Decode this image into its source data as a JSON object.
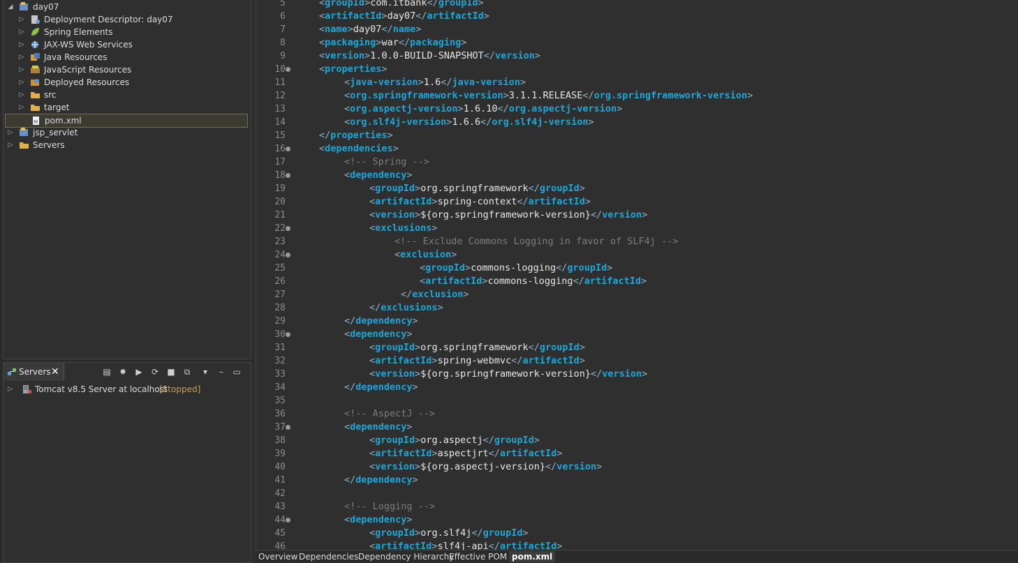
{
  "explorer": {
    "items": [
      {
        "label": "day07",
        "indent": 0,
        "arrow": "◢",
        "icon": "project-icon"
      },
      {
        "label": "Deployment Descriptor: day07",
        "indent": 1,
        "arrow": "▷",
        "icon": "descriptor-icon"
      },
      {
        "label": "Spring Elements",
        "indent": 1,
        "arrow": "▷",
        "icon": "spring-leaf-icon"
      },
      {
        "label": "JAX-WS Web Services",
        "indent": 1,
        "arrow": "▷",
        "icon": "webservice-icon"
      },
      {
        "label": "Java Resources",
        "indent": 1,
        "arrow": "▷",
        "icon": "java-resources-icon"
      },
      {
        "label": "JavaScript Resources",
        "indent": 1,
        "arrow": "▷",
        "icon": "js-resources-icon"
      },
      {
        "label": "Deployed Resources",
        "indent": 1,
        "arrow": "▷",
        "icon": "deployed-resources-icon"
      },
      {
        "label": "src",
        "indent": 1,
        "arrow": "▷",
        "icon": "folder-icon"
      },
      {
        "label": "target",
        "indent": 1,
        "arrow": "▷",
        "icon": "folder-icon"
      },
      {
        "label": "pom.xml",
        "indent": 1,
        "arrow": "",
        "icon": "xml-file-icon",
        "selected": true
      },
      {
        "label": "jsp_servlet",
        "indent": 0,
        "arrow": "▷",
        "icon": "project-icon"
      },
      {
        "label": "Servers",
        "indent": 0,
        "arrow": "▷",
        "icon": "folder-icon"
      }
    ]
  },
  "servers": {
    "tab_label": "Servers",
    "server_name": "Tomcat v8.5 Server at localhost",
    "server_status": "[Stopped]"
  },
  "editor": {
    "lines": [
      {
        "n": "5",
        "fold": false,
        "indent": 1,
        "parts": [
          [
            "t",
            "groupId"
          ],
          [
            "x",
            "com.itbank"
          ],
          [
            "c",
            "groupId"
          ]
        ]
      },
      {
        "n": "6",
        "fold": false,
        "indent": 1,
        "parts": [
          [
            "t",
            "artifactId"
          ],
          [
            "x",
            "day07"
          ],
          [
            "c",
            "artifactId"
          ]
        ]
      },
      {
        "n": "7",
        "fold": false,
        "indent": 1,
        "parts": [
          [
            "t",
            "name"
          ],
          [
            "x",
            "day07"
          ],
          [
            "c",
            "name"
          ]
        ]
      },
      {
        "n": "8",
        "fold": false,
        "indent": 1,
        "parts": [
          [
            "t",
            "packaging"
          ],
          [
            "x",
            "war"
          ],
          [
            "c",
            "packaging"
          ]
        ]
      },
      {
        "n": "9",
        "fold": false,
        "indent": 1,
        "parts": [
          [
            "t",
            "version"
          ],
          [
            "x",
            "1.0.0-BUILD-SNAPSHOT"
          ],
          [
            "c",
            "version"
          ]
        ]
      },
      {
        "n": "10",
        "fold": true,
        "indent": 1,
        "parts": [
          [
            "t",
            "properties"
          ]
        ]
      },
      {
        "n": "11",
        "fold": false,
        "indent": 2,
        "parts": [
          [
            "t",
            "java-version"
          ],
          [
            "x",
            "1.6"
          ],
          [
            "c",
            "java-version"
          ]
        ]
      },
      {
        "n": "12",
        "fold": false,
        "indent": 2,
        "parts": [
          [
            "t",
            "org.springframework-version"
          ],
          [
            "x",
            "3.1.1.RELEASE"
          ],
          [
            "c",
            "org.springframework-version"
          ]
        ]
      },
      {
        "n": "13",
        "fold": false,
        "indent": 2,
        "parts": [
          [
            "t",
            "org.aspectj-version"
          ],
          [
            "x",
            "1.6.10"
          ],
          [
            "c",
            "org.aspectj-version"
          ]
        ]
      },
      {
        "n": "14",
        "fold": false,
        "indent": 2,
        "parts": [
          [
            "t",
            "org.slf4j-version"
          ],
          [
            "x",
            "1.6.6"
          ],
          [
            "c",
            "org.slf4j-version"
          ]
        ]
      },
      {
        "n": "15",
        "fold": false,
        "indent": 1,
        "parts": [
          [
            "c",
            "properties"
          ]
        ]
      },
      {
        "n": "16",
        "fold": true,
        "indent": 1,
        "parts": [
          [
            "t",
            "dependencies"
          ]
        ]
      },
      {
        "n": "17",
        "fold": false,
        "indent": 2,
        "parts": [
          [
            "m",
            "<!-- Spring -->"
          ]
        ]
      },
      {
        "n": "18",
        "fold": true,
        "indent": 2,
        "parts": [
          [
            "t",
            "dependency"
          ]
        ]
      },
      {
        "n": "19",
        "fold": false,
        "indent": 3,
        "parts": [
          [
            "t",
            "groupId"
          ],
          [
            "x",
            "org.springframework"
          ],
          [
            "c",
            "groupId"
          ]
        ]
      },
      {
        "n": "20",
        "fold": false,
        "indent": 3,
        "parts": [
          [
            "t",
            "artifactId"
          ],
          [
            "x",
            "spring-context"
          ],
          [
            "c",
            "artifactId"
          ]
        ]
      },
      {
        "n": "21",
        "fold": false,
        "indent": 3,
        "parts": [
          [
            "t",
            "version"
          ],
          [
            "x",
            "${org.springframework-version}"
          ],
          [
            "c",
            "version"
          ]
        ]
      },
      {
        "n": "22",
        "fold": true,
        "indent": 3,
        "parts": [
          [
            "t",
            "exclusions"
          ]
        ]
      },
      {
        "n": "23",
        "fold": false,
        "indent": 4,
        "parts": [
          [
            "m",
            "<!-- Exclude Commons Logging in favor of SLF4j -->"
          ]
        ]
      },
      {
        "n": "24",
        "fold": true,
        "indent": 4,
        "parts": [
          [
            "t",
            "exclusion"
          ]
        ]
      },
      {
        "n": "25",
        "fold": false,
        "indent": 5,
        "parts": [
          [
            "t",
            "groupId"
          ],
          [
            "x",
            "commons-logging"
          ],
          [
            "c",
            "groupId"
          ]
        ]
      },
      {
        "n": "26",
        "fold": false,
        "indent": 5,
        "parts": [
          [
            "t",
            "artifactId"
          ],
          [
            "x",
            "commons-logging"
          ],
          [
            "c",
            "artifactId"
          ]
        ]
      },
      {
        "n": "27",
        "fold": false,
        "indent": 4.25,
        "parts": [
          [
            "c",
            "exclusion"
          ]
        ]
      },
      {
        "n": "28",
        "fold": false,
        "indent": 3,
        "parts": [
          [
            "c",
            "exclusions"
          ]
        ]
      },
      {
        "n": "29",
        "fold": false,
        "indent": 2,
        "parts": [
          [
            "c",
            "dependency"
          ]
        ]
      },
      {
        "n": "30",
        "fold": true,
        "indent": 2,
        "parts": [
          [
            "t",
            "dependency"
          ]
        ]
      },
      {
        "n": "31",
        "fold": false,
        "indent": 3,
        "parts": [
          [
            "t",
            "groupId"
          ],
          [
            "x",
            "org.springframework"
          ],
          [
            "c",
            "groupId"
          ]
        ]
      },
      {
        "n": "32",
        "fold": false,
        "indent": 3,
        "parts": [
          [
            "t",
            "artifactId"
          ],
          [
            "x",
            "spring-webmvc"
          ],
          [
            "c",
            "artifactId"
          ]
        ]
      },
      {
        "n": "33",
        "fold": false,
        "indent": 3,
        "parts": [
          [
            "t",
            "version"
          ],
          [
            "x",
            "${org.springframework-version}"
          ],
          [
            "c",
            "version"
          ]
        ]
      },
      {
        "n": "34",
        "fold": false,
        "indent": 2,
        "parts": [
          [
            "c",
            "dependency"
          ]
        ]
      },
      {
        "n": "35",
        "fold": false,
        "indent": 0,
        "parts": []
      },
      {
        "n": "36",
        "fold": false,
        "indent": 2,
        "parts": [
          [
            "m",
            "<!-- AspectJ -->"
          ]
        ]
      },
      {
        "n": "37",
        "fold": true,
        "indent": 2,
        "parts": [
          [
            "t",
            "dependency"
          ]
        ]
      },
      {
        "n": "38",
        "fold": false,
        "indent": 3,
        "parts": [
          [
            "t",
            "groupId"
          ],
          [
            "x",
            "org.aspectj"
          ],
          [
            "c",
            "groupId"
          ]
        ]
      },
      {
        "n": "39",
        "fold": false,
        "indent": 3,
        "parts": [
          [
            "t",
            "artifactId"
          ],
          [
            "x",
            "aspectjrt"
          ],
          [
            "c",
            "artifactId"
          ]
        ]
      },
      {
        "n": "40",
        "fold": false,
        "indent": 3,
        "parts": [
          [
            "t",
            "version"
          ],
          [
            "x",
            "${org.aspectj-version}"
          ],
          [
            "c",
            "version"
          ]
        ]
      },
      {
        "n": "41",
        "fold": false,
        "indent": 2,
        "parts": [
          [
            "c",
            "dependency"
          ]
        ]
      },
      {
        "n": "42",
        "fold": false,
        "indent": 0,
        "parts": []
      },
      {
        "n": "43",
        "fold": false,
        "indent": 2,
        "parts": [
          [
            "m",
            "<!-- Logging -->"
          ]
        ]
      },
      {
        "n": "44",
        "fold": true,
        "indent": 2,
        "parts": [
          [
            "t",
            "dependency"
          ]
        ]
      },
      {
        "n": "45",
        "fold": false,
        "indent": 3,
        "parts": [
          [
            "t",
            "groupId"
          ],
          [
            "x",
            "org.slf4j"
          ],
          [
            "c",
            "groupId"
          ]
        ]
      },
      {
        "n": "46",
        "fold": false,
        "indent": 3,
        "parts": [
          [
            "t",
            "artifactId"
          ],
          [
            "x",
            "slf4j-api"
          ],
          [
            "c",
            "artifactId"
          ]
        ]
      }
    ]
  },
  "bottom_tabs": [
    {
      "label": "Overview",
      "active": false
    },
    {
      "label": "Dependencies",
      "active": false
    },
    {
      "label": "Dependency Hierarchy",
      "active": false
    },
    {
      "label": "Effective POM",
      "active": false
    },
    {
      "label": "pom.xml",
      "active": true
    }
  ],
  "colors": {
    "tag": "#1fa7d8",
    "comment": "#7d7d7d",
    "status": "#c8a060",
    "background": "#2f2f2f"
  }
}
